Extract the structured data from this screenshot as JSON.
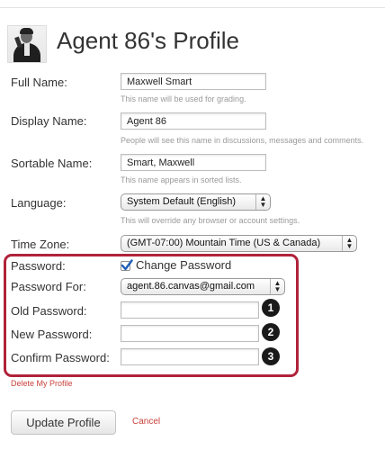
{
  "header": {
    "title": "Agent 86's Profile",
    "avatar_icon": "user-avatar-photo"
  },
  "fields": {
    "full_name": {
      "label": "Full Name:",
      "value": "Maxwell Smart",
      "hint": "This name will be used for grading."
    },
    "display_name": {
      "label": "Display Name:",
      "value": "Agent 86",
      "hint": "People will see this name in discussions, messages and comments."
    },
    "sortable_name": {
      "label": "Sortable Name:",
      "value": "Smart, Maxwell",
      "hint": "This name appears in sorted lists."
    },
    "language": {
      "label": "Language:",
      "value": "System Default (English)",
      "hint": "This will override any browser or account settings."
    },
    "time_zone": {
      "label": "Time Zone:",
      "value": "(GMT-07:00) Mountain Time (US & Canada)"
    }
  },
  "password_section": {
    "password_label": "Password:",
    "change_password_label": "Change Password",
    "change_password_checked": true,
    "password_for_label": "Password For:",
    "password_for_value": "agent.86.canvas@gmail.com",
    "old_password_label": "Old Password:",
    "new_password_label": "New Password:",
    "confirm_password_label": "Confirm Password:",
    "old_password_value": "",
    "new_password_value": "",
    "confirm_password_value": "",
    "step_badges": [
      "1",
      "2",
      "3"
    ],
    "highlight_color": "#b0233a"
  },
  "actions": {
    "delete_profile": "Delete My Profile",
    "update_profile": "Update Profile",
    "cancel": "Cancel"
  },
  "colors": {
    "link": "#c9413c",
    "hint_text": "#9a9a9a"
  }
}
